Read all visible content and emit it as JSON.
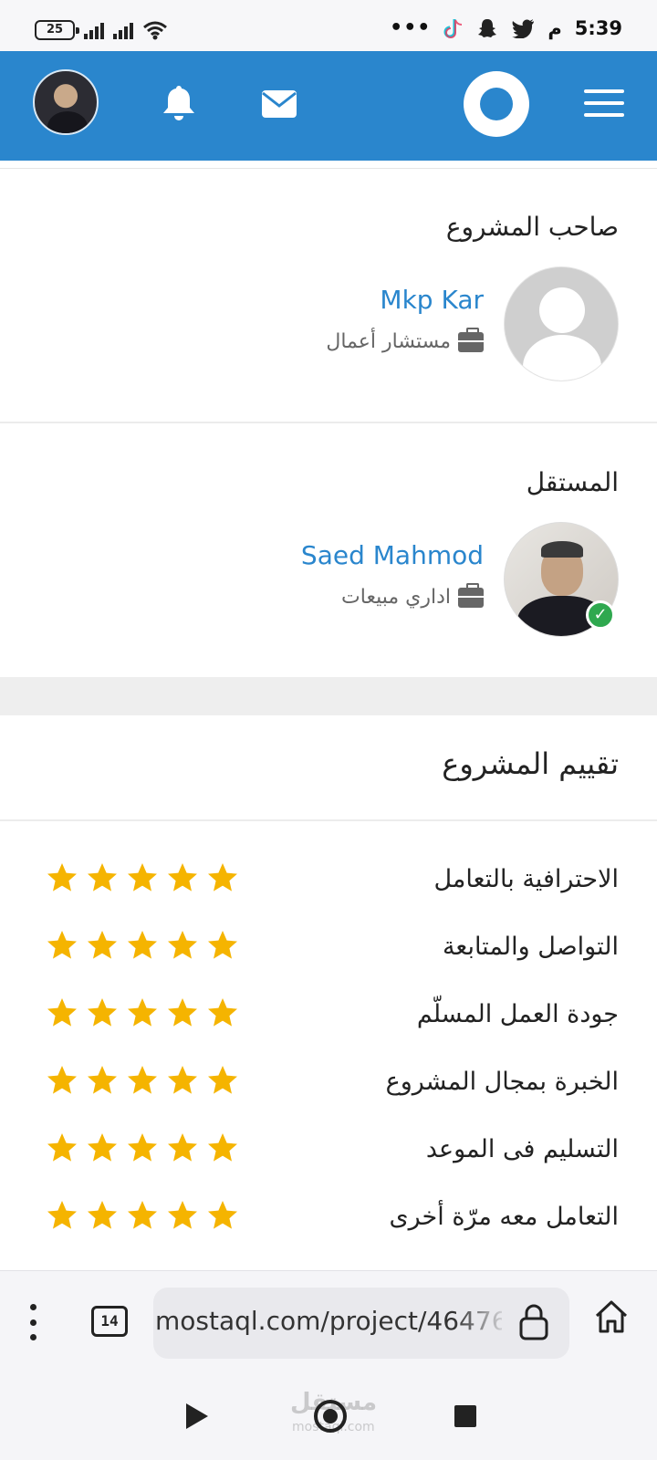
{
  "status_bar": {
    "battery": "25",
    "time": "5:39",
    "am_pm": "م",
    "more": "•••",
    "app_icons": [
      "tiktok-icon",
      "snapchat-icon",
      "twitter-icon"
    ]
  },
  "header": {
    "accent_color": "#2a86cd",
    "icons": [
      "avatar",
      "bell-icon",
      "mail-icon",
      "mostaql-logo",
      "menu-icon"
    ]
  },
  "owner": {
    "section_title": "صاحب المشروع",
    "name": "Mkp Kar",
    "role": "مستشار أعمال"
  },
  "freelancer": {
    "section_title": "المستقل",
    "name": "Saed Mahmod",
    "role": "اداري مبيعات",
    "verified": true
  },
  "rating": {
    "title": "تقييم المشروع",
    "star_color": "#f5b400",
    "max_stars": 5,
    "items": [
      {
        "label": "الاحترافية بالتعامل",
        "stars": 5
      },
      {
        "label": "التواصل والمتابعة",
        "stars": 5
      },
      {
        "label": "جودة العمل المسلّم",
        "stars": 5
      },
      {
        "label": "الخبرة بمجال المشروع",
        "stars": 5
      },
      {
        "label": "التسليم فى الموعد",
        "stars": 5
      },
      {
        "label": "التعامل معه مرّة أخرى",
        "stars": 5
      }
    ]
  },
  "browser": {
    "tab_count": "14",
    "url": "mostaql.com/project/46476"
  },
  "nav": {
    "watermark": "مستقل",
    "watermark_sub": "mostaql.com"
  }
}
